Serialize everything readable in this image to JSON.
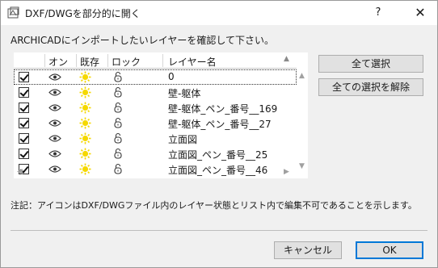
{
  "window": {
    "title": "DXF/DWGを部分的に開く",
    "help_label": "?",
    "close_label": "✕"
  },
  "instruction": "ARCHICADにインポートしたいレイヤーを確認して下さい。",
  "table": {
    "columns": [
      "オン",
      "既存",
      "ロック",
      "レイヤー名"
    ],
    "rows": [
      {
        "checked": true,
        "name": "0",
        "selected": true
      },
      {
        "checked": true,
        "name": "壁-躯体",
        "selected": false
      },
      {
        "checked": true,
        "name": "壁-躯体_ペン_番号__169",
        "selected": false
      },
      {
        "checked": true,
        "name": "壁-躯体_ペン_番号__27",
        "selected": false
      },
      {
        "checked": true,
        "name": "立面図",
        "selected": false
      },
      {
        "checked": true,
        "name": "立面図_ペン_番号__25",
        "selected": false
      },
      {
        "checked": true,
        "name": "立面図_ペン_番号__46",
        "selected": false
      }
    ],
    "icons": {
      "on": "eye-icon",
      "existing": "sun-icon",
      "lock": "lock-icon"
    }
  },
  "buttons": {
    "select_all": "全て選択",
    "deselect_all": "全ての選択を解除",
    "cancel": "キャンセル",
    "ok": "OK"
  },
  "note": "注記：アイコンはDXF/DWGファイル内のレイヤー状態とリスト内で編集不可であることを示します。",
  "colors": {
    "accent": "#0078d7",
    "sun": "#f5d800"
  }
}
